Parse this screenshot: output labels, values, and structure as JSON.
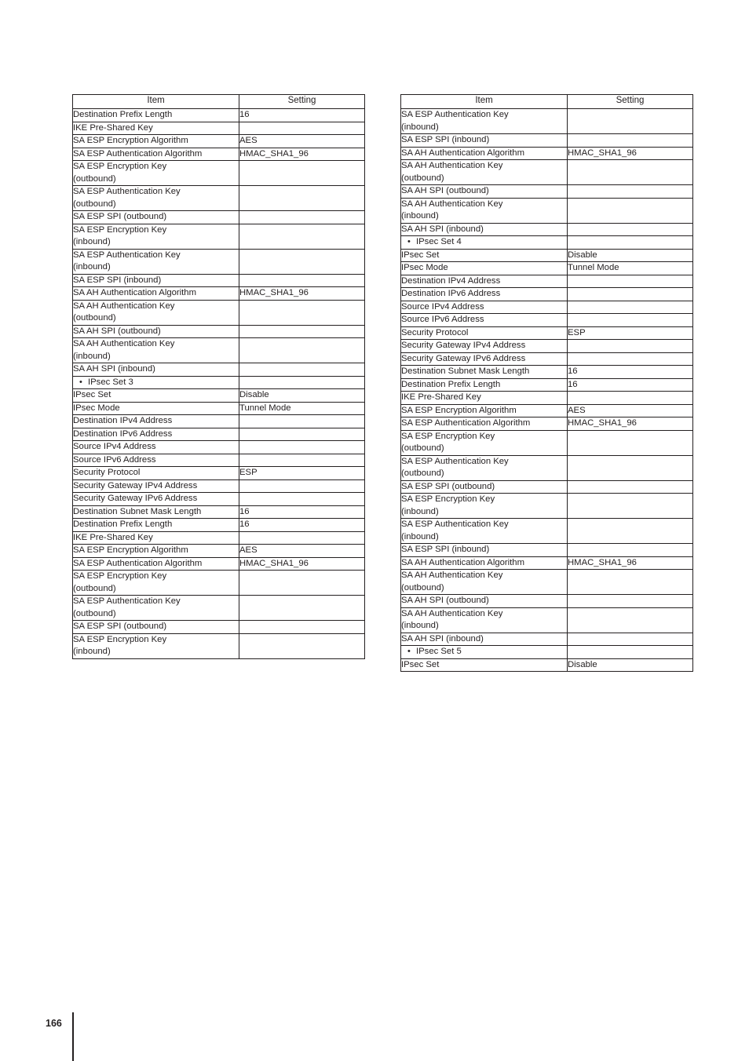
{
  "page": {
    "number": "166"
  },
  "tables": [
    {
      "id": "left-table",
      "headers": {
        "item": "Item",
        "setting": "Setting"
      },
      "rows": [
        {
          "item": "Destination Prefix Length",
          "setting": "16"
        },
        {
          "item": "IKE Pre-Shared Key",
          "setting": ""
        },
        {
          "item": "SA ESP Encryption Algorithm",
          "setting": "AES"
        },
        {
          "item": "SA ESP Authentication Algorithm",
          "setting": "HMAC_SHA1_96",
          "two_line": true
        },
        {
          "item": "SA ESP Encryption Key (outbound)",
          "setting": "",
          "two_line": true
        },
        {
          "item": "SA ESP Authentication Key (outbound)",
          "setting": "",
          "two_line": true
        },
        {
          "item": "SA ESP SPI (outbound)",
          "setting": ""
        },
        {
          "item": "SA ESP Encryption Key (inbound)",
          "setting": "",
          "two_line": true
        },
        {
          "item": "SA ESP Authentication Key (inbound)",
          "setting": "",
          "two_line": true
        },
        {
          "item": "SA ESP SPI (inbound)",
          "setting": ""
        },
        {
          "item": "SA AH Authentication Algorithm",
          "setting": "HMAC_SHA1_96"
        },
        {
          "item": "SA AH Authentication Key (outbound)",
          "setting": "",
          "two_line": true
        },
        {
          "item": "SA AH SPI (outbound)",
          "setting": ""
        },
        {
          "item": "SA AH Authentication Key (inbound)",
          "setting": "",
          "two_line": true
        },
        {
          "item": "SA AH SPI (inbound)",
          "setting": ""
        },
        {
          "item": "IPsec Set 3",
          "setting": "",
          "group": true
        },
        {
          "item": "IPsec Set",
          "setting": "Disable"
        },
        {
          "item": "IPsec Mode",
          "setting": "Tunnel Mode"
        },
        {
          "item": "Destination IPv4 Address",
          "setting": ""
        },
        {
          "item": "Destination IPv6 Address",
          "setting": ""
        },
        {
          "item": "Source IPv4 Address",
          "setting": ""
        },
        {
          "item": "Source IPv6 Address",
          "setting": ""
        },
        {
          "item": "Security Protocol",
          "setting": "ESP"
        },
        {
          "item": "Security Gateway IPv4 Address",
          "setting": ""
        },
        {
          "item": "Security Gateway IPv6 Address",
          "setting": ""
        },
        {
          "item": "Destination Subnet Mask Length",
          "setting": "16"
        },
        {
          "item": "Destination Prefix Length",
          "setting": "16"
        },
        {
          "item": "IKE Pre-Shared Key",
          "setting": ""
        },
        {
          "item": "SA ESP Encryption Algorithm",
          "setting": "AES"
        },
        {
          "item": "SA ESP Authentication Algorithm",
          "setting": "HMAC_SHA1_96",
          "two_line": true
        },
        {
          "item": "SA ESP Encryption Key (outbound)",
          "setting": "",
          "two_line": true
        },
        {
          "item": "SA ESP Authentication Key (outbound)",
          "setting": "",
          "two_line": true
        },
        {
          "item": "SA ESP SPI (outbound)",
          "setting": ""
        },
        {
          "item": "SA ESP Encryption Key (inbound)",
          "setting": "",
          "two_line": true
        }
      ]
    },
    {
      "id": "right-table",
      "headers": {
        "item": "Item",
        "setting": "Setting"
      },
      "rows": [
        {
          "item": "SA ESP Authentication Key (inbound)",
          "setting": "",
          "two_line": true
        },
        {
          "item": "SA ESP SPI (inbound)",
          "setting": ""
        },
        {
          "item": "SA AH Authentication Algorithm",
          "setting": "HMAC_SHA1_96"
        },
        {
          "item": "SA AH Authentication Key (outbound)",
          "setting": "",
          "two_line": true
        },
        {
          "item": "SA AH SPI (outbound)",
          "setting": ""
        },
        {
          "item": "SA AH Authentication Key (inbound)",
          "setting": "",
          "two_line": true
        },
        {
          "item": "SA AH SPI (inbound)",
          "setting": ""
        },
        {
          "item": "IPsec Set 4",
          "setting": "",
          "group": true
        },
        {
          "item": "IPsec Set",
          "setting": "Disable"
        },
        {
          "item": "IPsec Mode",
          "setting": "Tunnel Mode"
        },
        {
          "item": "Destination IPv4 Address",
          "setting": ""
        },
        {
          "item": "Destination IPv6 Address",
          "setting": ""
        },
        {
          "item": "Source IPv4 Address",
          "setting": ""
        },
        {
          "item": "Source IPv6 Address",
          "setting": ""
        },
        {
          "item": "Security Protocol",
          "setting": "ESP"
        },
        {
          "item": "Security Gateway IPv4 Address",
          "setting": ""
        },
        {
          "item": "Security Gateway IPv6 Address",
          "setting": ""
        },
        {
          "item": "Destination Subnet Mask Length",
          "setting": "16"
        },
        {
          "item": "Destination Prefix Length",
          "setting": "16"
        },
        {
          "item": "IKE Pre-Shared Key",
          "setting": ""
        },
        {
          "item": "SA ESP Encryption Algorithm",
          "setting": "AES"
        },
        {
          "item": "SA ESP Authentication Algorithm",
          "setting": "HMAC_SHA1_96",
          "two_line": true
        },
        {
          "item": "SA ESP Encryption Key (outbound)",
          "setting": "",
          "two_line": true
        },
        {
          "item": "SA ESP Authentication Key (outbound)",
          "setting": "",
          "two_line": true
        },
        {
          "item": "SA ESP SPI (outbound)",
          "setting": ""
        },
        {
          "item": "SA ESP Encryption Key (inbound)",
          "setting": "",
          "two_line": true
        },
        {
          "item": "SA ESP Authentication Key (inbound)",
          "setting": "",
          "two_line": true
        },
        {
          "item": "SA ESP SPI (inbound)",
          "setting": ""
        },
        {
          "item": "SA AH Authentication Algorithm",
          "setting": "HMAC_SHA1_96"
        },
        {
          "item": "SA AH Authentication Key (outbound)",
          "setting": "",
          "two_line": true
        },
        {
          "item": "SA AH SPI (outbound)",
          "setting": ""
        },
        {
          "item": "SA AH Authentication Key (inbound)",
          "setting": "",
          "two_line": true
        },
        {
          "item": "SA AH SPI (inbound)",
          "setting": ""
        },
        {
          "item": "IPsec Set 5",
          "setting": "",
          "group": true
        },
        {
          "item": "IPsec Set",
          "setting": "Disable"
        }
      ]
    }
  ]
}
